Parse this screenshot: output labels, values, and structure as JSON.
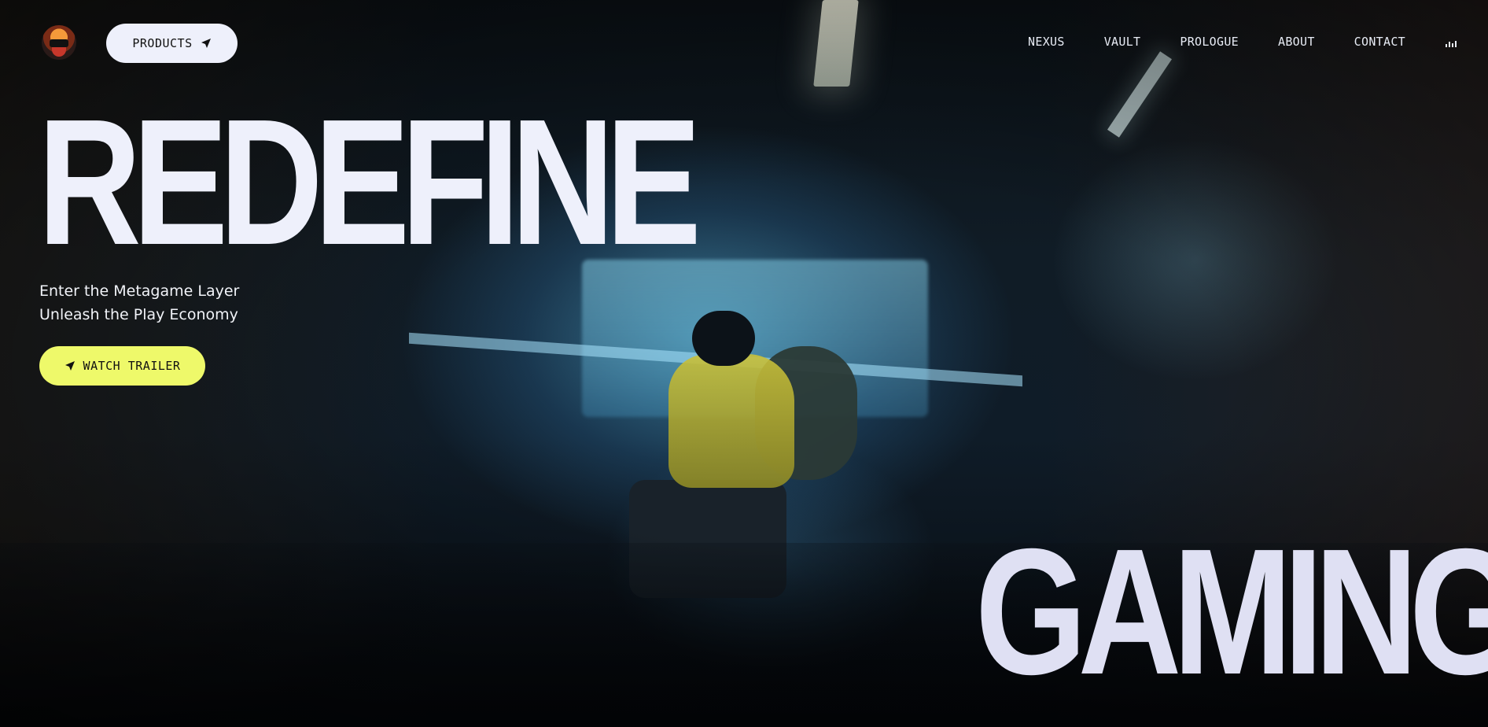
{
  "nav": {
    "products_label": "PRODUCTS",
    "links": [
      "NEXUS",
      "VAULT",
      "PROLOGUE",
      "ABOUT",
      "CONTACT"
    ],
    "audio_icon": "audio-bars-icon",
    "logo_icon": "ninja-avatar-logo"
  },
  "hero": {
    "headline_top": "REDEFINE",
    "headline_bottom": "GAMING",
    "subtitle_line1": "Enter the Metagame Layer",
    "subtitle_line2": "Unleash the Play Economy",
    "cta_label": "WATCH TRAILER",
    "cta_icon": "navigation-arrow-icon"
  },
  "colors": {
    "headline": "#eef0fb",
    "cta_background": "#eef96a",
    "products_background": "#eef0fb",
    "nav_text": "#e8ecf5"
  }
}
